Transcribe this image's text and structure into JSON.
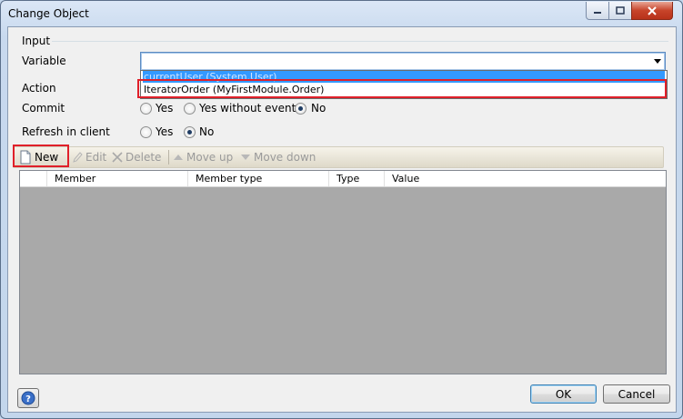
{
  "window": {
    "title": "Change Object",
    "minimize_glyph": "─",
    "maximize_glyph": "☐",
    "close_glyph": "✕"
  },
  "input_group": {
    "title": "Input",
    "variable_label": "Variable",
    "variable_value": "",
    "dropdown_options": [
      "currentUser (System.User)",
      "IteratorOrder (MyFirstModule.Order)"
    ],
    "selected_option_index": 0,
    "hovered_option_index": 1
  },
  "action_group": {
    "title": "Action",
    "commit_label": "Commit",
    "commit_options": [
      "Yes",
      "Yes without events",
      "No"
    ],
    "commit_selected": "No",
    "refresh_label": "Refresh in client",
    "refresh_options": [
      "Yes",
      "No"
    ],
    "refresh_selected": "No"
  },
  "toolbar": {
    "new_label": "New",
    "edit_label": "Edit",
    "delete_label": "Delete",
    "move_up_label": "Move up",
    "move_down_label": "Move down",
    "icons": [
      "new-document-icon",
      "pencil-icon",
      "delete-x-icon",
      "triangle-up-icon",
      "triangle-down-icon"
    ]
  },
  "grid": {
    "columns": [
      "",
      "Member",
      "Member type",
      "Type",
      "Value"
    ],
    "rows": []
  },
  "footer": {
    "ok_label": "OK",
    "cancel_label": "Cancel",
    "help_icon": "help-question-icon"
  },
  "colors": {
    "highlight": "#e0202a",
    "selection": "#3399ff",
    "grid_background": "#a9a9a9"
  }
}
